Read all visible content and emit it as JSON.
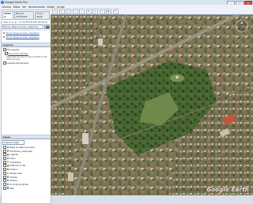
{
  "window": {
    "title": "Google Earth Pro",
    "controls": [
      "_",
      "□",
      "×"
    ]
  },
  "menu": [
    "Archivo",
    "Editar",
    "Ver",
    "Herramientas",
    "Añadir",
    "Ayuda"
  ],
  "search": {
    "tabs": [
      "Volar a",
      "Buscar empresas",
      "Cómo llegar"
    ],
    "label": "Volar a: p. ej., 37 25.818 N 122 05.36 W",
    "query": "Olivos, Buenos Aires, Argentina",
    "results": [
      "Olivos, Buenos Aires, Argentina",
      "Olivos, Buenos Aires, Argentina"
    ]
  },
  "places": {
    "header": "Lugares",
    "items": [
      {
        "label": "Mis lugares",
        "link": false,
        "sub": false
      },
      {
        "label": "Recorrido turístico",
        "link": true,
        "sub": true
      }
    ],
    "description": "Asegúrate de que la capa de Edificios 3D esté marcada",
    "temp": "Lugares temporales"
  },
  "layers": {
    "header": "Capas",
    "view": "Vista principal",
    "items": [
      {
        "label": "Base de datos principal",
        "color": "#5b8fd6"
      },
      {
        "label": "Fronteras y etiquetas",
        "color": "#c9a227"
      },
      {
        "label": "Lugares",
        "color": "#e07a3f"
      },
      {
        "label": "Fotos",
        "color": "#3aa1c9"
      },
      {
        "label": "Carreteras",
        "color": "#d6c64a"
      },
      {
        "label": "Edificios en 3D",
        "color": "#8c8c8c"
      },
      {
        "label": "Océano",
        "color": "#2f76c2"
      },
      {
        "label": "Street View",
        "color": "#f2a33a"
      },
      {
        "label": "Tiempo",
        "color": "#67a0d8"
      },
      {
        "label": "Galería",
        "color": "#9b6ad1"
      },
      {
        "label": "Conciencia global",
        "color": "#43a047"
      },
      {
        "label": "Más",
        "color": "#7b8794"
      }
    ]
  },
  "toolbar": [
    "▭",
    "✋",
    "◯",
    "▱",
    "⌁",
    "✉",
    "⎙",
    "☀",
    "◐",
    "⟳"
  ],
  "brand": "Google Earth"
}
